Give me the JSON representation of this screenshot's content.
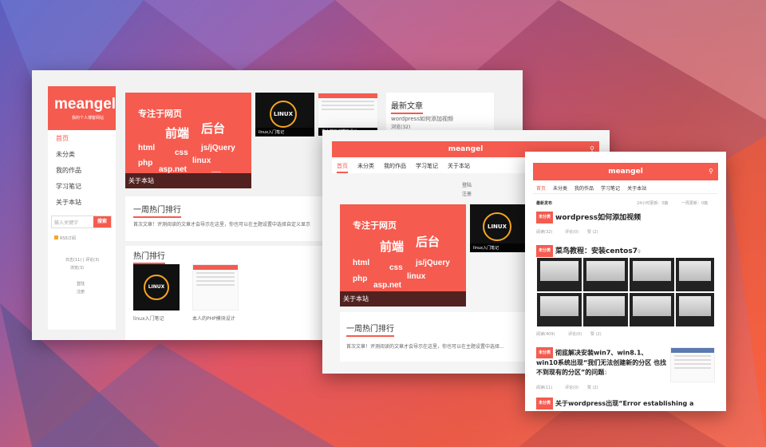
{
  "w1": {
    "logo": {
      "name": "meangel",
      "subtitle": "我的个人博客网站"
    },
    "nav": [
      "首页",
      "未分类",
      "我的作品",
      "学习笔记",
      "关于本站"
    ],
    "search": {
      "placeholder": "输入关键字",
      "button": "搜索"
    },
    "rss": "RSS订阅",
    "stats": [
      "日志(11) | 评论(3)",
      "浏览(3)"
    ],
    "misc": [
      "登陆",
      "注册"
    ],
    "banner": {
      "lines": [
        "专注于网页",
        "前端",
        "后台",
        "html",
        "css",
        "js/jQuery",
        "php",
        "linux",
        "asp.net",
        "......"
      ],
      "caption": "关于本站"
    },
    "thumbs": [
      {
        "title": "linux入门笔记",
        "logo": "LINUX"
      },
      {
        "title": "本人的PHP模块设计"
      }
    ],
    "latest": {
      "title": "最新文章",
      "items": [
        "wordpress如何添加视频",
        "浏览(32)"
      ]
    },
    "weekly": {
      "title": "一周热门排行",
      "desc": "首次文章！评测阅读的文章才会导示在这里，你也可以在主题设置中选择自定义显示"
    },
    "hot": {
      "title": "热门排行",
      "items": [
        "linux入门笔记",
        "本人的PHP模块设计"
      ]
    }
  },
  "w2": {
    "brand": "meangel",
    "nav": [
      "首页",
      "未分类",
      "我的作品",
      "学习笔记",
      "关于本站"
    ],
    "auth": [
      "登陆",
      "注册"
    ],
    "banner": {
      "lines": [
        "专注于网页",
        "前端",
        "后台",
        "html",
        "css",
        "js/jQuery",
        "php",
        "linux",
        "asp.net"
      ],
      "caption": "关于本站"
    },
    "thumb": {
      "title": "linux入门笔记",
      "logo": "LINUX"
    },
    "weekly": {
      "title": "一周热门排行",
      "desc": "首次文章！评测阅读的文章才会导示在这里，你也可以在主题设置中选择..."
    }
  },
  "w3": {
    "brand": "meangel",
    "nav": [
      "首页",
      "未分类",
      "我的作品",
      "学习笔记",
      "关于本站"
    ],
    "header": {
      "left": "最新发布",
      "right1": "24小时更新：0篇",
      "right2": "一周更新：0篇"
    },
    "posts": [
      {
        "tag": "未分类",
        "title": "wordpress如何添加视频",
        "meta": [
          "阅读(32)",
          "评论(0)",
          "赞 (2)"
        ]
      },
      {
        "tag": "未分类",
        "title": "菜鸟教程：安装centos7",
        "suffix": "9",
        "meta": [
          "阅读(409)",
          "评论(0)",
          "赞 (2)"
        ]
      },
      {
        "tag": "未分类",
        "title": "彻底解决安装win7、win8.1、win10系统出现“我们无法创建新的分区 也找不到现有的分区”的问题",
        "suffix": "1",
        "meta": [
          "阅读(11)",
          "评论(0)",
          "赞 (2)"
        ]
      },
      {
        "tag": "未分类",
        "title": "关于wordpress出现“Error establishing a"
      }
    ]
  },
  "colors": {
    "accent": "#f55b4f"
  }
}
